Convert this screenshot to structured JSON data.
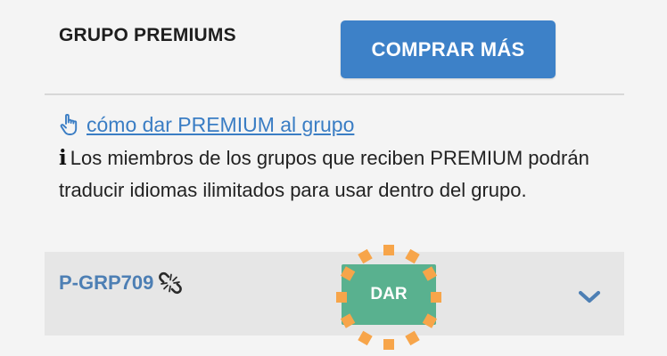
{
  "header": {
    "title": "GRUPO PREMIUMS",
    "buy_button_label": "COMPRAR MÁS"
  },
  "howto": {
    "icon": "hand-pointer-icon",
    "link_text": "cómo dar PREMIUM al grupo"
  },
  "info": {
    "icon": "info-icon",
    "glyph": "i",
    "text": "Los miembros de los grupos que reciben PREMIUM podrán traducir idiomas ilimitados para usar dentro del grupo."
  },
  "premium_row": {
    "code": "P-GRP709",
    "code_icon": "unlink-icon",
    "give_button_label": "DAR",
    "expand_icon": "chevron-down-icon"
  },
  "colors": {
    "accent_blue": "#3d81c8",
    "link_blue": "#3a7dc4",
    "code_blue": "#4d7fb4",
    "give_green": "#59b18f",
    "highlight_orange": "#f7a54a",
    "row_gray": "#e6e6e6",
    "background": "#f4f4f4"
  }
}
